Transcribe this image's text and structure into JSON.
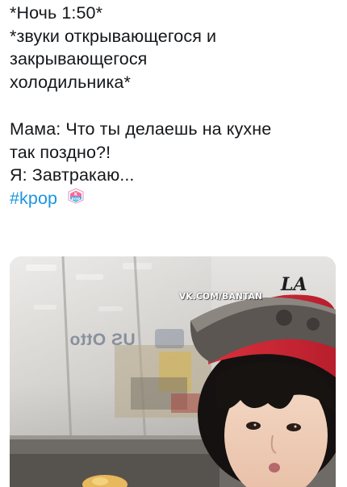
{
  "tweet": {
    "lines": [
      "*Ночь 1:50*",
      "*звуки открывающегося и",
      "закрывающегося",
      "холодильника*",
      "Мама: Что ты делаешь на кухне",
      "так поздно?!",
      "Я: Завтракаю..."
    ],
    "hashtag": "#kpop",
    "hashtag_badge": "K POP",
    "link_color": "#1b95e0"
  },
  "media": {
    "watermark": "VK.COM/BANTAN",
    "glass_sign": "US Ottо",
    "cap_logo": "LA"
  }
}
